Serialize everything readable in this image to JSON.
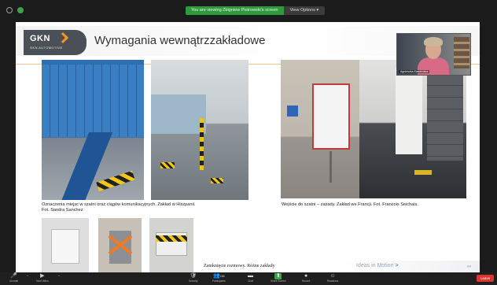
{
  "banner": {
    "share_text": "You are viewing Zbigniew Piotrowski's screen",
    "view_options": "View Options"
  },
  "slide": {
    "logo_text": "GKN",
    "logo_sub": "GKN AUTOMOTIVE",
    "title": "Wymagania wewnątrzzakładowe",
    "caption_left_1": "Oznaczenia miejsc w szatni oraz ciągów komunikacyjnych. Zakład w Hiszpanii.",
    "caption_left_2": "Fot. Sandra Sanchez",
    "caption_right": "Wejście do szatni – zasady. Zakład we Francji. Fot. Francois Seichais.",
    "sub_caption": "Zamknięcie rozmowy. Różne zakłady",
    "tagline": "Ideas in Motion",
    "tagline_chevron": ">",
    "page_number": "##"
  },
  "video": {
    "participant_name": "Agnieszka Kamienska"
  },
  "toolbar": {
    "items": [
      {
        "label": "Unmute",
        "icon": "microphone-icon",
        "glyph": "🎤"
      },
      {
        "label": "Start Video",
        "icon": "camera-icon",
        "glyph": "▶"
      },
      {
        "label": "Security",
        "icon": "shield-icon",
        "glyph": "🛡"
      },
      {
        "label": "Participants",
        "icon": "participants-icon",
        "glyph": "👥",
        "count": "165"
      },
      {
        "label": "Chat",
        "icon": "chat-icon",
        "glyph": "▬"
      },
      {
        "label": "Share Screen",
        "icon": "share-screen-icon",
        "glyph": "⬆"
      },
      {
        "label": "Record",
        "icon": "record-icon",
        "glyph": "●"
      },
      {
        "label": "Reactions",
        "icon": "reactions-icon",
        "glyph": "☺"
      }
    ],
    "leave_label": "Leave"
  },
  "colors": {
    "share_green": "#2f9a3d",
    "accent_orange": "#f39a1e",
    "leave_red": "#e0342f",
    "locker_blue": "#2f6eb0"
  }
}
